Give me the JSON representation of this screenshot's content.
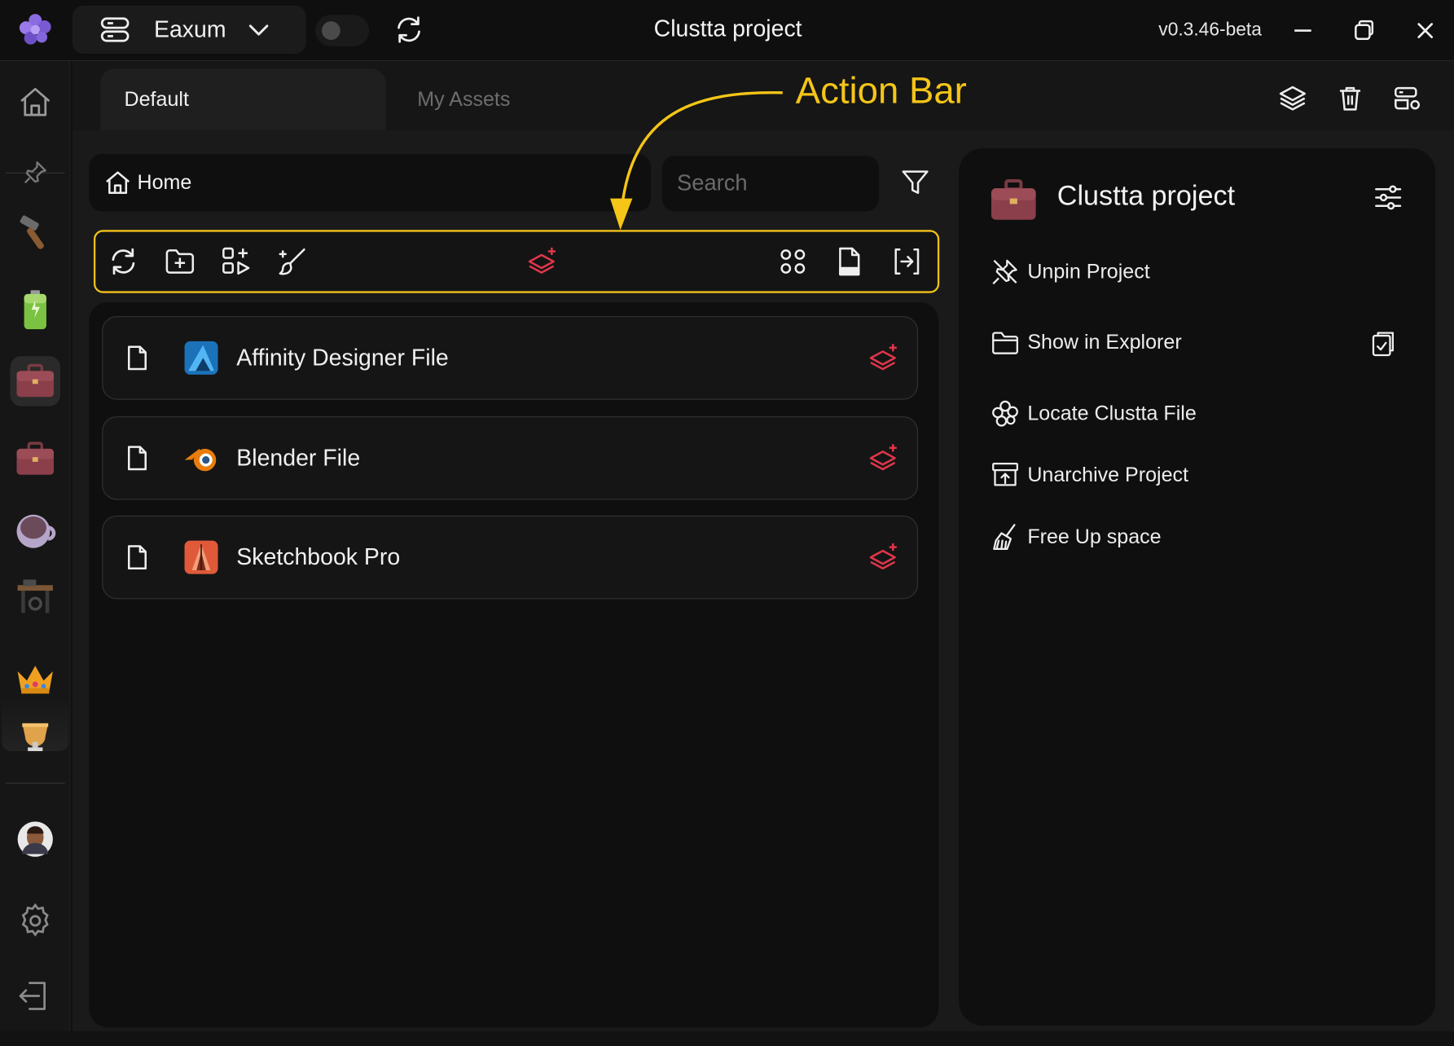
{
  "window": {
    "title": "Clustta project",
    "version": "v0.3.46-beta"
  },
  "workspace": {
    "name": "Eaxum"
  },
  "tabs": [
    {
      "label": "Default",
      "active": true
    },
    {
      "label": "My Assets",
      "active": false
    }
  ],
  "breadcrumb": {
    "label": "Home"
  },
  "search": {
    "placeholder": "Search"
  },
  "annotation": {
    "label": "Action Bar",
    "color": "#f5c518"
  },
  "files": [
    {
      "name": "Affinity Designer File",
      "app_icon": "affinity-designer-icon"
    },
    {
      "name": "Blender File",
      "app_icon": "blender-icon"
    },
    {
      "name": "Sketchbook Pro",
      "app_icon": "sketchbook-icon"
    }
  ],
  "project_panel": {
    "title": "Clustta project",
    "actions": [
      {
        "label": "Unpin Project",
        "icon": "unpin-icon"
      },
      {
        "label": "Show in Explorer",
        "icon": "folder-icon"
      },
      {
        "label": "Locate Clustta File",
        "icon": "clustta-logo-icon"
      },
      {
        "label": "Unarchive Project",
        "icon": "unarchive-icon"
      },
      {
        "label": "Free Up space",
        "icon": "broom-icon"
      }
    ]
  },
  "colors": {
    "accent_yellow": "#f2c21a",
    "stack_red": "#e0364a",
    "background": "#101010"
  }
}
